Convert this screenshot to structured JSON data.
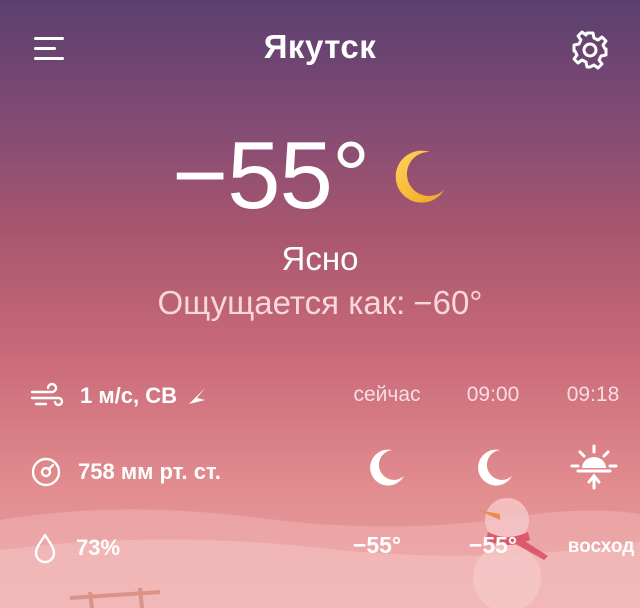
{
  "header": {
    "city": "Якутск",
    "menu_icon": "hamburger-menu-icon",
    "settings_icon": "gear-icon"
  },
  "current": {
    "temperature": "−55°",
    "condition": "Ясно",
    "feels_like_label": "Ощущается как:",
    "feels_like_value": "−60°",
    "icon": "moon-icon"
  },
  "details": {
    "wind": "1 м/с, СВ",
    "wind_icon": "wind-icon",
    "wind_direction_icon": "direction-arrow-icon",
    "pressure": "758 мм рт. ст.",
    "pressure_icon": "barometer-icon",
    "humidity": "73%",
    "humidity_icon": "droplet-icon"
  },
  "forecast": [
    {
      "time": "сейчас",
      "icon": "moon-icon",
      "value": "−55°"
    },
    {
      "time": "09:00",
      "icon": "moon-icon",
      "value": "−55°"
    },
    {
      "time": "09:18",
      "icon": "sunrise-icon",
      "value": "восход"
    }
  ],
  "colors": {
    "sky_top": "#5a3f6e",
    "sky_bottom": "#eaa3a3",
    "moon": "#f7b52a",
    "text": "#ffffff"
  }
}
